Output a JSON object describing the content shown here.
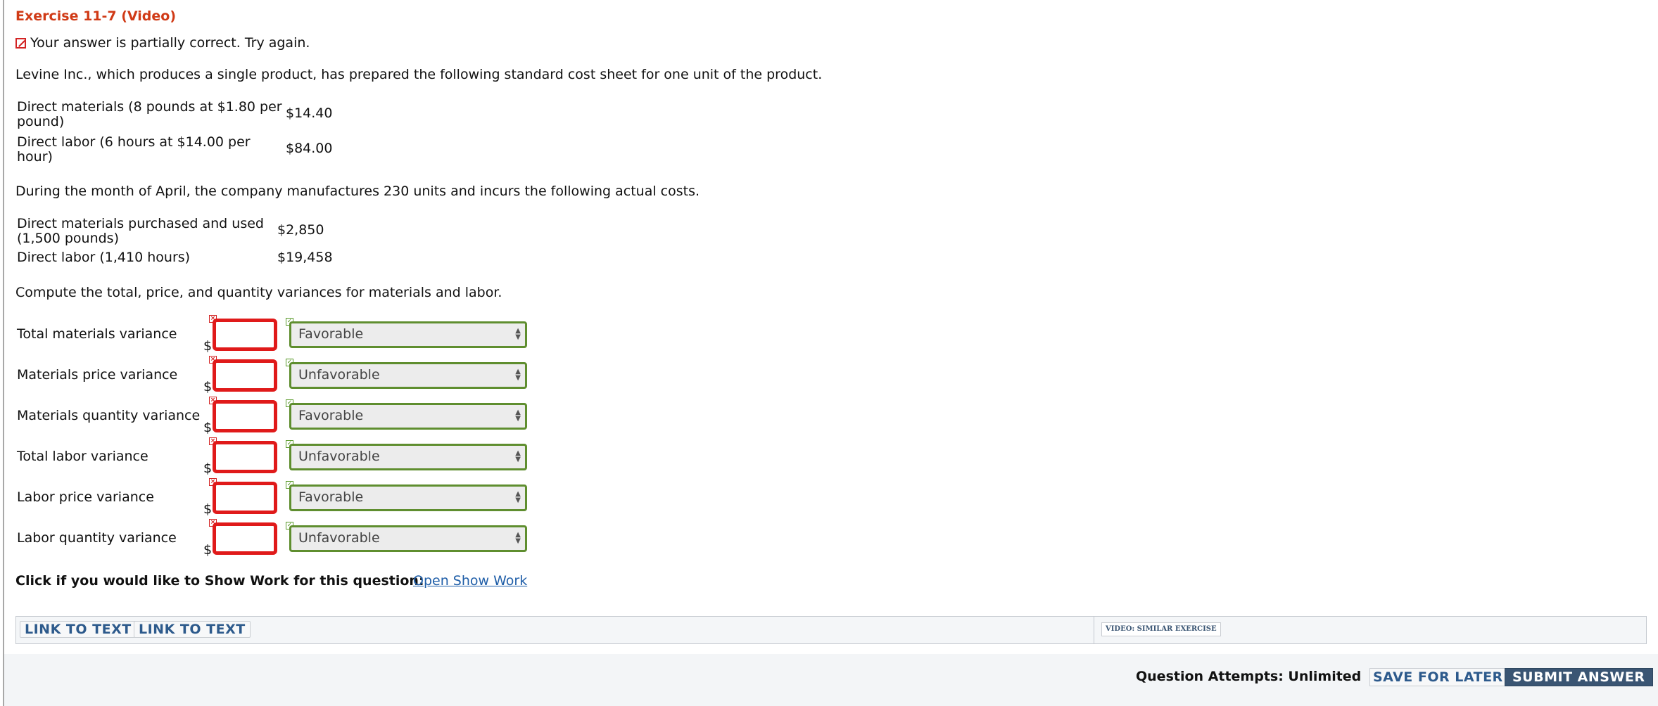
{
  "title": "Exercise 11-7 (Video)",
  "status": {
    "icon": "pencil-square-icon",
    "text": "Your answer is partially correct.  Try again."
  },
  "intro": "Levine Inc., which produces a single product, has prepared the following standard cost sheet for one unit of the product.",
  "standard_costs": [
    {
      "label_line1": "Direct materials (8 pounds at $1.80 per",
      "label_line2": "pound)",
      "value": "$14.40"
    },
    {
      "label_line1": "Direct labor (6 hours at $14.00 per",
      "label_line2": "hour)",
      "value": "$84.00"
    }
  ],
  "april_intro": "During the month of April, the company manufactures 230 units and incurs the following actual costs.",
  "actual_costs": [
    {
      "label_line1": "Direct materials purchased and used",
      "label_line2": "(1,500 pounds)",
      "value": "$2,850"
    },
    {
      "label_line1": "Direct labor (1,410 hours)",
      "label_line2": "",
      "value": "$19,458"
    }
  ],
  "instruction": "Compute the total, price, and quantity variances for materials and labor.",
  "variances": [
    {
      "label": "Total materials variance",
      "currency": "$",
      "amount": "",
      "selection": "Favorable"
    },
    {
      "label": "Materials price variance",
      "currency": "$",
      "amount": "",
      "selection": "Unfavorable"
    },
    {
      "label": "Materials quantity variance",
      "currency": "$",
      "amount": "",
      "selection": "Favorable"
    },
    {
      "label": "Total labor variance",
      "currency": "$",
      "amount": "",
      "selection": "Unfavorable"
    },
    {
      "label": "Labor price variance",
      "currency": "$",
      "amount": "",
      "selection": "Favorable"
    },
    {
      "label": "Labor quantity variance",
      "currency": "$",
      "amount": "",
      "selection": "Unfavorable"
    }
  ],
  "show_work": {
    "prompt": "Click if you would like to Show Work for this question:",
    "link": "Open Show Work"
  },
  "links": {
    "link1": "LINK TO TEXT",
    "link2": "LINK TO TEXT",
    "video": "VIDEO: SIMILAR EXERCISE"
  },
  "footer": {
    "attempts": "Question Attempts: Unlimited",
    "save": "SAVE FOR LATER",
    "submit": "SUBMIT ANSWER"
  },
  "colors": {
    "title": "#d03a16",
    "incorrect_border": "#e01a1a",
    "correct_border": "#5f8e2f",
    "link": "#1f5ea8",
    "submit_bg": "#3a5573"
  }
}
